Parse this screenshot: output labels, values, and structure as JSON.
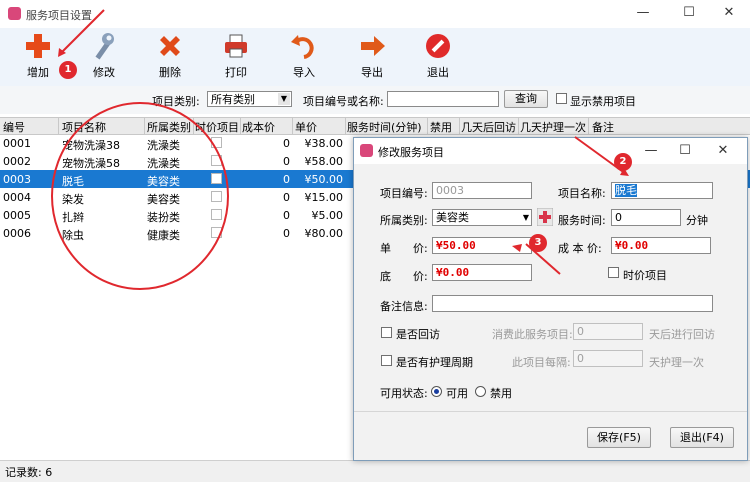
{
  "window": {
    "title": "服务项目设置",
    "controls": [
      "—",
      "☐",
      "✕"
    ]
  },
  "toolbar": {
    "buttons": [
      {
        "label": "增加",
        "icon": "plus-icon"
      },
      {
        "label": "修改",
        "icon": "wrench-icon"
      },
      {
        "label": "删除",
        "icon": "delete-x-icon"
      },
      {
        "label": "打印",
        "icon": "printer-icon"
      },
      {
        "label": "导入",
        "icon": "import-arrow-icon"
      },
      {
        "label": "导出",
        "icon": "export-arrow-icon"
      },
      {
        "label": "退出",
        "icon": "exit-icon"
      }
    ]
  },
  "filter": {
    "category_label": "项目类别:",
    "category_value": "所有类别",
    "search_label": "项目编号或名称:",
    "search_value": "",
    "query_button": "查询",
    "show_disabled_label": "显示禁用项目"
  },
  "grid": {
    "columns": [
      "编号",
      "项目名称",
      "所属类别",
      "时价项目",
      "成本价",
      "单价",
      "服务时间(分钟)",
      "禁用",
      "几天后回访",
      "几天护理一次",
      "备注"
    ],
    "rows": [
      {
        "id": "0001",
        "name": "宠物洗澡38",
        "cat": "洗澡类",
        "cost": "0",
        "price": "¥38.00",
        "selected": false
      },
      {
        "id": "0002",
        "name": "宠物洗澡58",
        "cat": "洗澡类",
        "cost": "0",
        "price": "¥58.00",
        "selected": false
      },
      {
        "id": "0003",
        "name": "脱毛",
        "cat": "美容类",
        "cost": "0",
        "price": "¥50.00",
        "selected": true
      },
      {
        "id": "0004",
        "name": "染发",
        "cat": "美容类",
        "cost": "0",
        "price": "¥15.00",
        "selected": false
      },
      {
        "id": "0005",
        "name": "扎辫",
        "cat": "装扮类",
        "cost": "0",
        "price": "¥5.00",
        "selected": false
      },
      {
        "id": "0006",
        "name": "除虫",
        "cat": "健康类",
        "cost": "0",
        "price": "¥80.00",
        "selected": false
      }
    ]
  },
  "status": {
    "record_count": "记录数: 6"
  },
  "dialog": {
    "title": "修改服务项目",
    "controls": [
      "—",
      "☐",
      "✕"
    ],
    "code_label": "项目编号:",
    "code_value": "0003",
    "name_label": "项目名称:",
    "name_value": "脱毛",
    "category_label": "所属类别:",
    "category_value": "美容类",
    "service_time_label": "服务时间:",
    "service_time_value": "0",
    "service_time_unit": "分钟",
    "price_label": "单　　价:",
    "price_value": "¥50.00",
    "cost_label": "成 本 价:",
    "cost_value": "¥0.00",
    "floor_label": "底　　价:",
    "floor_value": "¥0.00",
    "time_price_label": "时价项目",
    "notes_label": "备注信息:",
    "notes_value": "",
    "revisit_label": "是否回访",
    "revisit_note": "消费此服务项目:",
    "revisit_value": "0",
    "revisit_suffix": "天后进行回访",
    "care_label": "是否有护理周期",
    "care_note": "此项目每隔:",
    "care_value": "0",
    "care_suffix": "天护理一次",
    "status_label": "可用状态:",
    "status_enabled": "可用",
    "status_disabled": "禁用",
    "save_button": "保存(F5)",
    "exit_button": "退出(F4)"
  },
  "annotations": [
    "1",
    "2",
    "3"
  ],
  "colors": {
    "selection": "#1a79d1",
    "annotation": "#e0282e",
    "price_text": "#e00000"
  }
}
